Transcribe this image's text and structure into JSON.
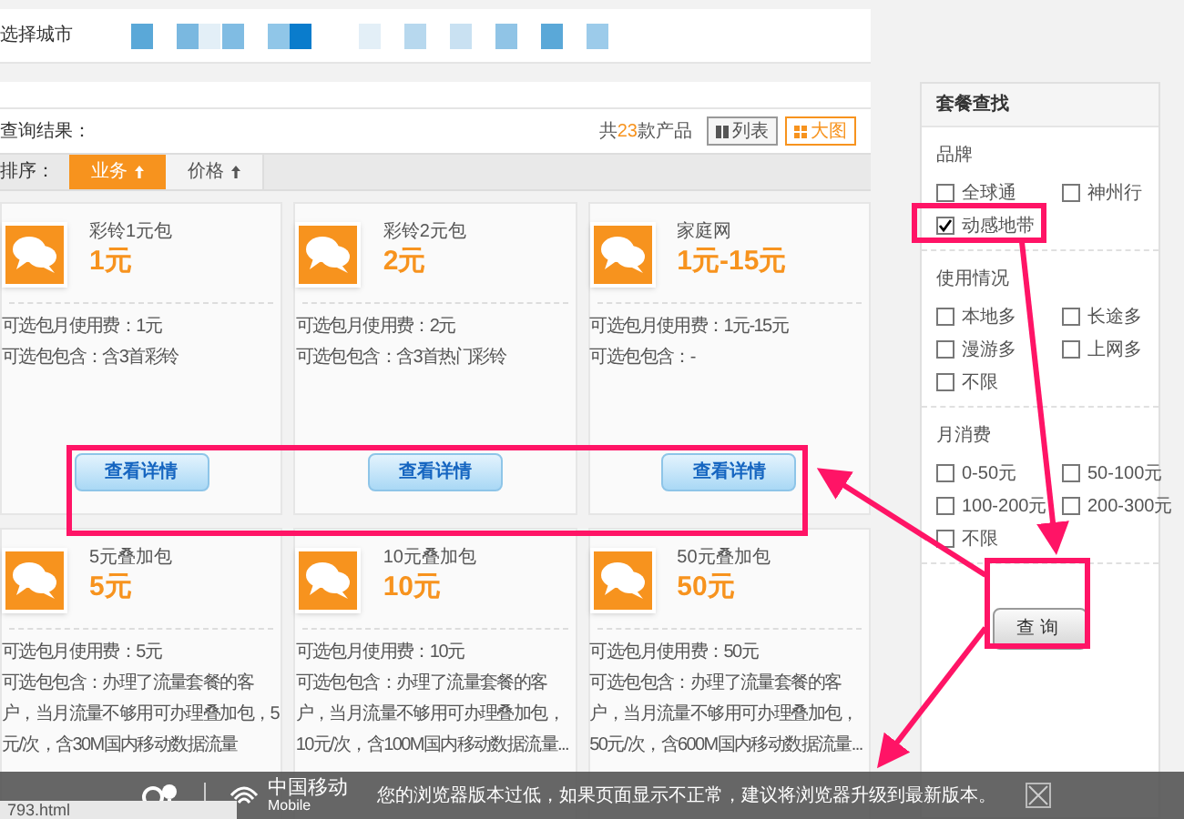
{
  "city_bar": {
    "label": "选择城市"
  },
  "results": {
    "title": "查询结果：",
    "count_prefix": "共",
    "count": "23",
    "count_suffix": "款产品",
    "views": [
      {
        "label": "列表",
        "kind": "list",
        "selected": false
      },
      {
        "label": "大图",
        "kind": "grid",
        "selected": true
      }
    ]
  },
  "sort": {
    "label": "排序：",
    "options": [
      {
        "label": "业务",
        "selected": true
      },
      {
        "label": "价格",
        "selected": false
      }
    ]
  },
  "cards": [
    {
      "name": "彩铃1元包",
      "price": "1元",
      "lines": [
        "可选包月使用费：1元",
        "可选包包含：含3首彩铃"
      ],
      "button": "查看详情"
    },
    {
      "name": "彩铃2元包",
      "price": "2元",
      "lines": [
        "可选包月使用费：2元",
        "可选包包含：含3首热门彩铃"
      ],
      "button": "查看详情"
    },
    {
      "name": "家庭网",
      "price": "1元-15元",
      "lines": [
        "可选包月使用费：1元-15元",
        "可选包包含：-"
      ],
      "button": "查看详情"
    },
    {
      "name": "5元叠加包",
      "price": "5元",
      "lines": [
        "可选包月使用费：5元",
        "可选包包含：办理了流量套餐的客",
        "户，当月流量不够用可办理叠加包，5",
        "元/次，含30M国内移动数据流量"
      ]
    },
    {
      "name": "10元叠加包",
      "price": "10元",
      "lines": [
        "可选包月使用费：10元",
        "可选包包含：办理了流量套餐的客",
        "户，当月流量不够用可办理叠加包，",
        "10元/次，含100M国内移动数据流量..."
      ]
    },
    {
      "name": "50元叠加包",
      "price": "50元",
      "lines": [
        "可选包月使用费：50元",
        "可选包包含：办理了流量套餐的客",
        "户，当月流量不够用可办理叠加包，",
        "50元/次，含600M国内移动数据流量..."
      ]
    }
  ],
  "filter": {
    "title": "套餐查找",
    "groups": [
      {
        "title": "品牌",
        "options": [
          {
            "label": "全球通",
            "checked": false
          },
          {
            "label": "神州行",
            "checked": false
          },
          {
            "label": "动感地带",
            "checked": true
          }
        ]
      },
      {
        "title": "使用情况",
        "options": [
          {
            "label": "本地多",
            "checked": false
          },
          {
            "label": "长途多",
            "checked": false
          },
          {
            "label": "漫游多",
            "checked": false
          },
          {
            "label": "上网多",
            "checked": false
          },
          {
            "label": "不限",
            "checked": false
          }
        ]
      },
      {
        "title": "月消费",
        "options": [
          {
            "label": "0-50元",
            "checked": false
          },
          {
            "label": "50-100元",
            "checked": false
          },
          {
            "label": "100-200元",
            "checked": false
          },
          {
            "label": "200-300元",
            "checked": false
          },
          {
            "label": "不限",
            "checked": false
          }
        ]
      }
    ],
    "button": "查询"
  },
  "notice_bar": {
    "brand": "中国移动",
    "brand_sub": "Mobile",
    "message": "您的浏览器版本过低，如果页面显示不正常，建议将浏览器升级到最新版本。"
  },
  "status_url": "793.html"
}
